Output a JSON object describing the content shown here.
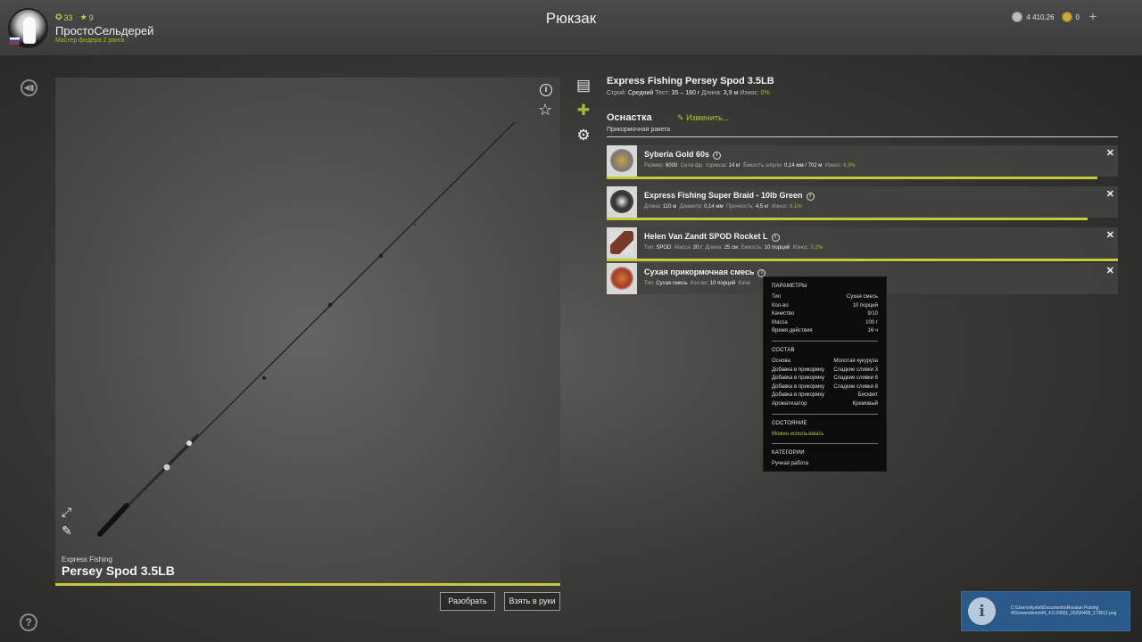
{
  "header": {
    "title": "Рюкзак",
    "username": "ПростоСельдерей",
    "rank": "Мастер фидера 2 ранга",
    "level": "33",
    "stars": "9",
    "silver": "4 410,26",
    "gold": "0",
    "add_label": "+"
  },
  "preview": {
    "brand": "Express Fishing",
    "model": "Persey Spod 3.5LB",
    "disassemble_label": "Разобрать",
    "take_label": "Взять в руки"
  },
  "item": {
    "title": "Express Fishing Persey Spod 3.5LB",
    "build_label": "Строй:",
    "build": "Средний",
    "test_label": "Тест:",
    "test": "35 – 160 г",
    "length_label": "Длина:",
    "length": "3,9 м",
    "wear_label": "Износ:",
    "wear": "0%"
  },
  "tackle": {
    "label": "Оснастка",
    "change_label": "Изменить...",
    "type": "Прикормочная ракета",
    "rows": [
      {
        "name": "Syberia Gold 60s",
        "props": [
          {
            "k": "Размер:",
            "v": "6000"
          },
          {
            "k": "Сила фр. тормоза:",
            "v": "14 кг"
          },
          {
            "k": "Ёмкость шпули:",
            "v": "0,14 мм / 702 м"
          },
          {
            "k": "Износ:",
            "v": "4,3%"
          }
        ],
        "durability": 0.96
      },
      {
        "name": "Express Fishing Super Braid - 10lb Green",
        "props": [
          {
            "k": "Длина:",
            "v": "110 м"
          },
          {
            "k": "Диаметр:",
            "v": "0,14 мм"
          },
          {
            "k": "Прочность:",
            "v": "4,5 кг"
          },
          {
            "k": "Износ:",
            "v": "6,1%"
          }
        ],
        "durability": 0.94
      },
      {
        "name": "Helen Van Zandt SPOD Rocket L",
        "props": [
          {
            "k": "Тип:",
            "v": "SPOD"
          },
          {
            "k": "Масса:",
            "v": "20 г"
          },
          {
            "k": "Длина:",
            "v": "25 см"
          },
          {
            "k": "Емкость:",
            "v": "10 порций"
          },
          {
            "k": "Износ:",
            "v": "0,2%"
          }
        ],
        "durability": 1.0
      },
      {
        "name": "Сухая прикормочная смесь",
        "props": [
          {
            "k": "Тип:",
            "v": "Сухая смесь"
          },
          {
            "k": "Кол-во:",
            "v": "10 порций"
          },
          {
            "k": "Каче",
            "v": ""
          }
        ],
        "durability": 0
      }
    ]
  },
  "tooltip": {
    "params_title": "ПАРАМЕТРЫ",
    "params": [
      {
        "k": "Тип",
        "v": "Сухая смесь"
      },
      {
        "k": "Кол-во",
        "v": "10 порций"
      },
      {
        "k": "Качество",
        "v": "9/10"
      },
      {
        "k": "Масса",
        "v": "100 г"
      },
      {
        "k": "Время действия",
        "v": "16 ч"
      }
    ],
    "composition_title": "СОСТАВ",
    "composition": [
      {
        "k": "Основа",
        "v": "Молотая кукуруза"
      },
      {
        "k": "Добавка в прикормку",
        "v": "Сладкие сливки 3"
      },
      {
        "k": "Добавка в прикормку",
        "v": "Сладкие сливки 6"
      },
      {
        "k": "Добавка в прикормку",
        "v": "Сладкие сливки 8"
      },
      {
        "k": "Добавка в прикормку",
        "v": "Бисквит"
      },
      {
        "k": "Ароматизатор",
        "v": "Кремовый"
      }
    ],
    "state_title": "СОСТОЯНИЕ",
    "state": "Можно использовать",
    "categories_title": "КАТЕГОРИИ",
    "category": "Ручная работа"
  },
  "notification": {
    "text": "C:\\Users\\Ayelet\\Documents\\Russian Fishing 4\\Screenshots\\rf4_4.0.29501_20200408_173612.png"
  },
  "colors": {
    "accent": "#c2cc3a",
    "accent_text": "#a7b83a",
    "notif": "#2a5a8a"
  }
}
